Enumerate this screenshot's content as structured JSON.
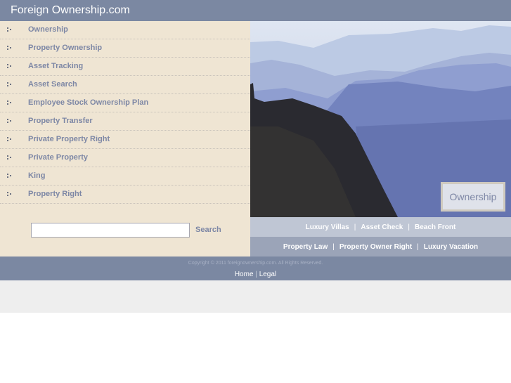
{
  "header": {
    "title": "Foreign Ownership.com"
  },
  "sidebar": {
    "items": [
      {
        "label": "Ownership"
      },
      {
        "label": "Property Ownership"
      },
      {
        "label": "Asset Tracking"
      },
      {
        "label": "Asset Search"
      },
      {
        "label": "Employee Stock Ownership Plan"
      },
      {
        "label": "Property Transfer"
      },
      {
        "label": "Private Property Right"
      },
      {
        "label": "Private Property"
      },
      {
        "label": "King"
      },
      {
        "label": "Property Right"
      }
    ],
    "bullet_icon": "bullet-dots-icon"
  },
  "search": {
    "value": "",
    "placeholder": "",
    "button_label": "Search"
  },
  "hero": {
    "image": "canyon-landscape-photo",
    "badge_label": "Ownership"
  },
  "links_row1": [
    "Luxury Villas",
    "Asset Check",
    "Beach Front"
  ],
  "links_row2": [
    "Property Law",
    "Property Owner Right",
    "Luxury Vacation"
  ],
  "separator": "|",
  "footer": {
    "copyright": "Copyright © 2011 foreignownership.com. All Rights Reserved.",
    "links": [
      "Home",
      "Legal"
    ],
    "separator": "|"
  },
  "colors": {
    "header_bg": "#7b88a2",
    "sidebar_bg": "#efe5d3",
    "link_text": "#7d87a5",
    "links_row1_bg": "#bfc6d4",
    "links_row2_bg": "#9ba4b8"
  }
}
